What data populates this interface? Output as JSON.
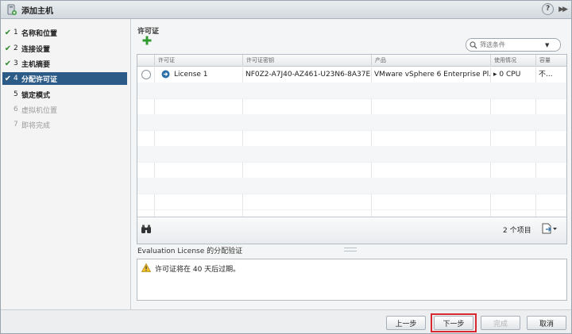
{
  "window": {
    "title": "添加主机"
  },
  "steps": [
    {
      "num": "1",
      "label": "名称和位置",
      "state": "done"
    },
    {
      "num": "2",
      "label": "连接设置",
      "state": "done"
    },
    {
      "num": "3",
      "label": "主机摘要",
      "state": "done"
    },
    {
      "num": "4",
      "label": "分配许可证",
      "state": "current"
    },
    {
      "num": "5",
      "label": "锁定模式",
      "state": "pending"
    },
    {
      "num": "6",
      "label": "虚拟机位置",
      "state": "disabled"
    },
    {
      "num": "7",
      "label": "即将完成",
      "state": "disabled"
    }
  ],
  "license": {
    "section_title": "许可证",
    "filter_placeholder": "筛选条件",
    "columns": [
      "许可证",
      "许可证密钥",
      "产品",
      "使用情况",
      "容量"
    ],
    "rows": [
      {
        "name": "License 1",
        "key": "NF0Z2-A7J40-AZ461-U23N6-8A37E",
        "product": "VMware vSphere 6 Enterprise Pl...",
        "usage": "0 CPU",
        "capacity": "不..."
      }
    ],
    "item_count": "2 个项目"
  },
  "evaluation": {
    "title": "Evaluation License 的分配验证",
    "message": "许可证将在 40 天后过期。"
  },
  "buttons": {
    "back": "上一步",
    "next": "下一步",
    "finish": "完成",
    "cancel": "取消"
  },
  "colors": {
    "accent": "#2b5b86",
    "check": "#2f8a2f",
    "highlight": "#d9282f"
  }
}
